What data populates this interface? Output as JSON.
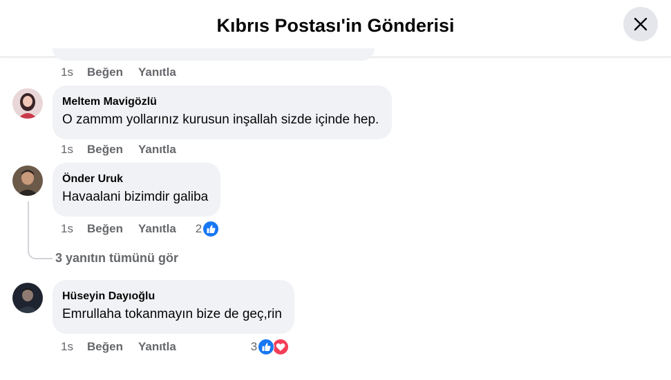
{
  "header": {
    "title": "Kıbrıs Postası'in Gönderisi"
  },
  "actions": {
    "like": "Beğen",
    "reply": "Yanıtla"
  },
  "top_meta": {
    "time": "1s"
  },
  "comments": [
    {
      "name": "Meltem Mavigözlü",
      "text": "O zammm yollarınız kurusun inşallah sizde içinde hep.",
      "time": "1s",
      "reaction_count": ""
    },
    {
      "name": "Önder Uruk",
      "text": "Havaalani bizimdir galiba",
      "time": "1s",
      "reaction_count": "2"
    },
    {
      "name": "Hüseyin Dayıoğlu",
      "text": "Emrullaha tokanmayın bize de geç,rin",
      "time": "1s",
      "reaction_count": "3"
    }
  ],
  "view_replies": "3 yanıtın tümünü gör",
  "colors": {
    "like_blue": "#1877f2",
    "love_red": "#f33e58",
    "bubble_bg": "#f0f2f5",
    "meta_gray": "#65676b"
  },
  "icons": {
    "close": "close-icon",
    "like": "like-reaction-icon",
    "love": "love-reaction-icon"
  }
}
